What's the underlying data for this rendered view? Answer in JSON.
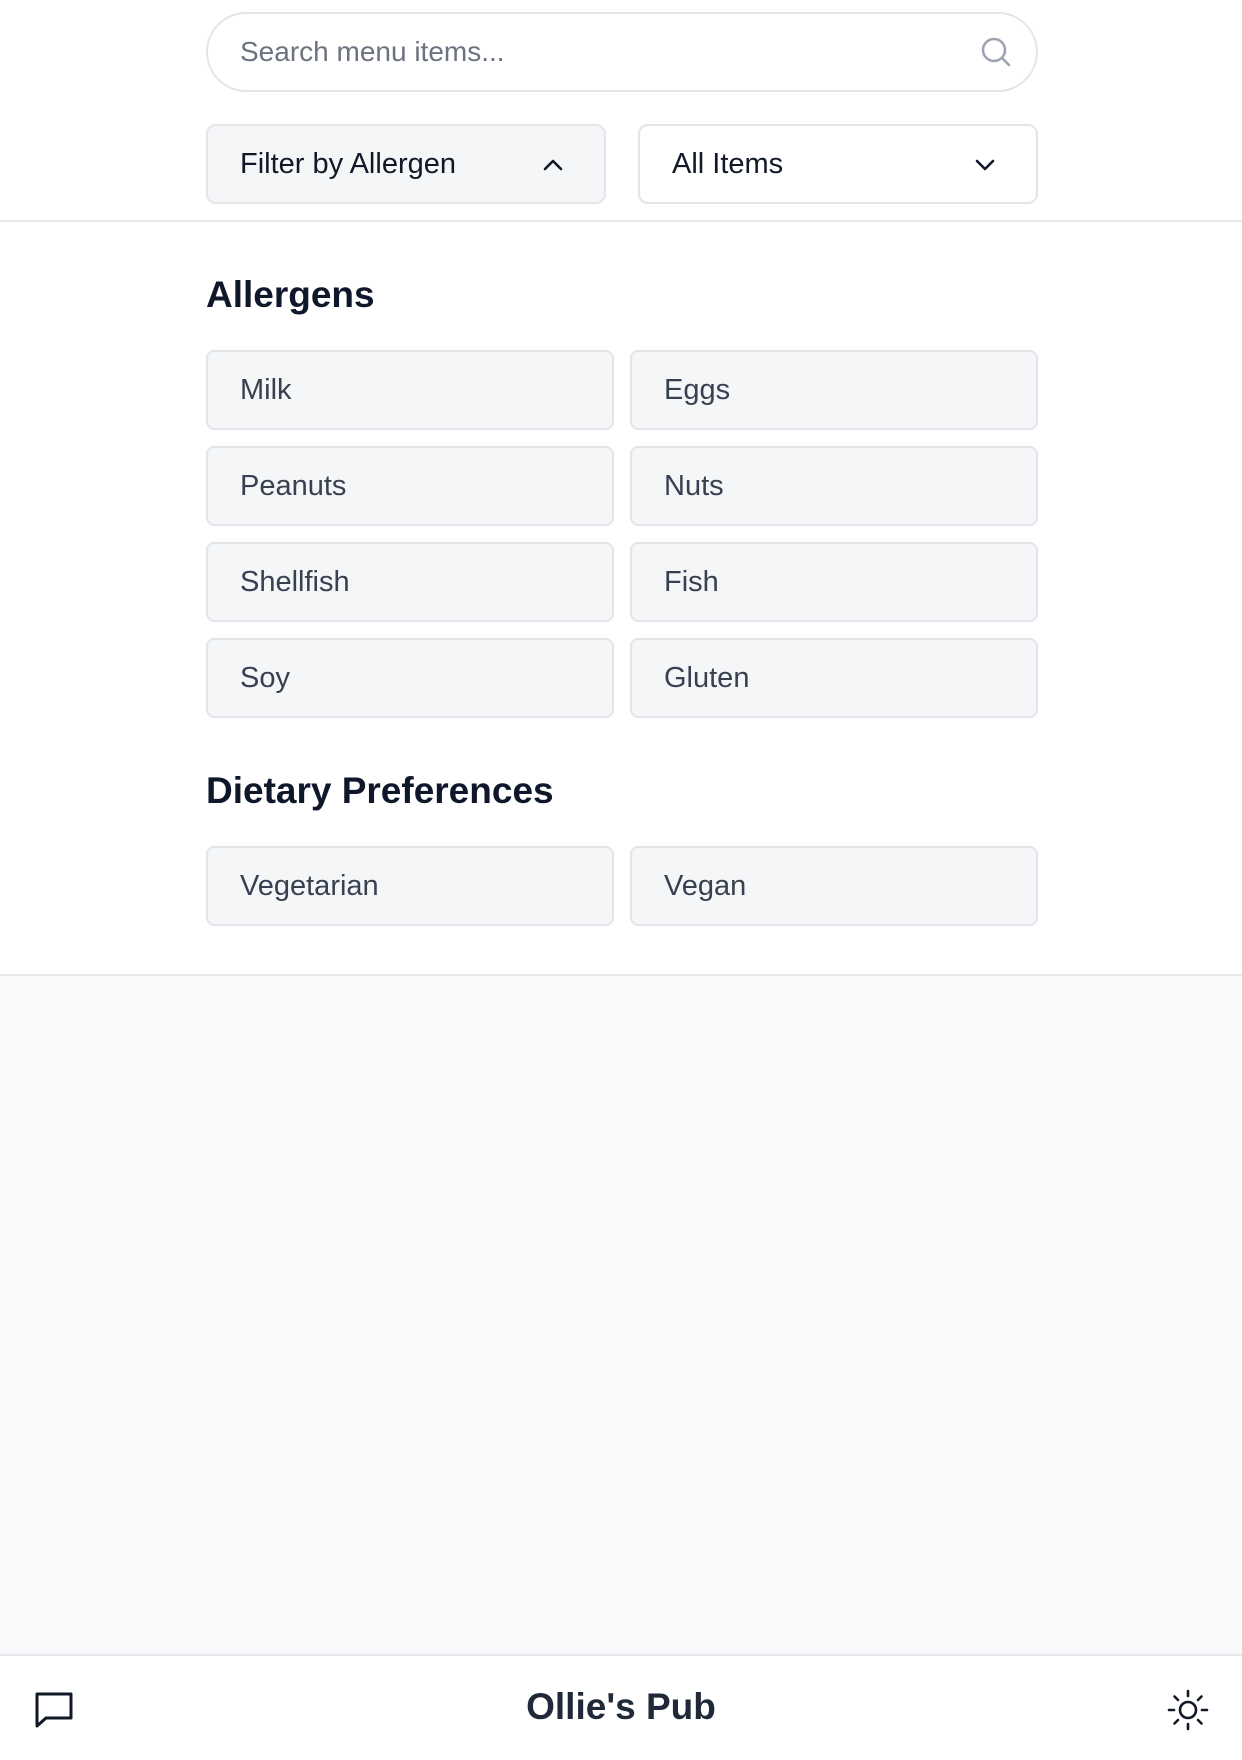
{
  "search": {
    "placeholder": "Search menu items...",
    "value": ""
  },
  "filters": {
    "allergen_dropdown_label": "Filter by Allergen",
    "items_dropdown_label": "All Items"
  },
  "allergens": {
    "title": "Allergens",
    "items": [
      "Milk",
      "Eggs",
      "Peanuts",
      "Nuts",
      "Shellfish",
      "Fish",
      "Soy",
      "Gluten"
    ]
  },
  "dietary": {
    "title": "Dietary Preferences",
    "items": [
      "Vegetarian",
      "Vegan"
    ]
  },
  "footer": {
    "brand": "Ollie's Pub"
  },
  "icons": [
    "search-icon",
    "chevron-up-icon",
    "chevron-down-icon",
    "chat-icon",
    "sun-icon"
  ],
  "colors": {
    "background": "#f8f9fb",
    "panel": "#ffffff",
    "chip": "#f5f6f8",
    "border": "#e2e5ea",
    "text": "#1f2937"
  }
}
